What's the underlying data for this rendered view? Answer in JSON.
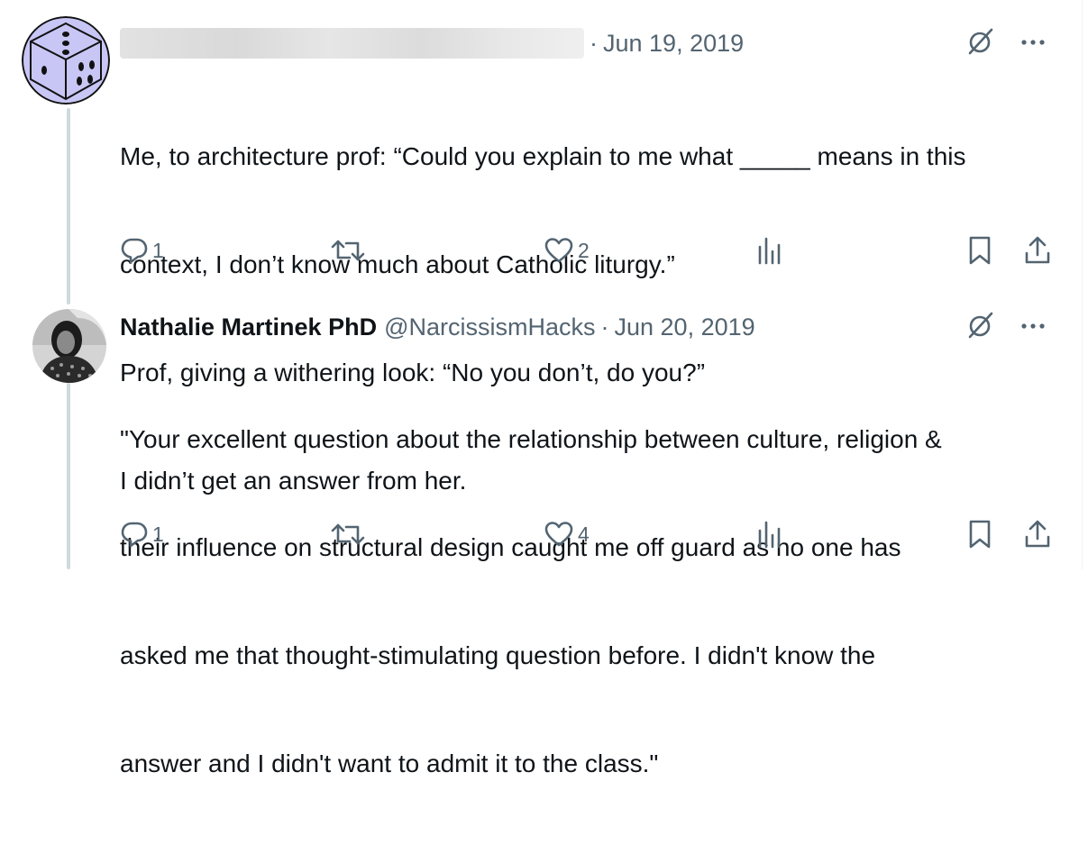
{
  "tweets": [
    {
      "author_name": "",
      "handle": "",
      "separator": "·",
      "date": "Jun 19, 2019",
      "lines": [
        "Me, to architecture prof: “Could you explain to me what _____ means in this",
        "context, I don’t know much about Catholic liturgy.”",
        "Prof, giving a withering look: “No you don’t, do you?”",
        "I didn’t get an answer from her."
      ],
      "reply_count": "1",
      "retweet_count": "",
      "like_count": "2",
      "view_count": ""
    },
    {
      "author_name": "Nathalie Martinek PhD",
      "handle": "@NarcissismHacks",
      "separator": "·",
      "date": "Jun 20, 2019",
      "lines": [
        "\"Your excellent question about the relationship between culture, religion &",
        "their influence on structural design caught me off guard as no one has",
        "asked me that thought-stimulating question before. I didn't know the",
        "answer and I didn't want to admit it to the class.\""
      ],
      "reply_count": "1",
      "retweet_count": "",
      "like_count": "4",
      "view_count": ""
    }
  ],
  "icons": {
    "grok": "grok-icon",
    "more": "more-icon",
    "reply": "reply-icon",
    "retweet": "retweet-icon",
    "like": "like-icon",
    "views": "views-icon",
    "bookmark": "bookmark-icon",
    "share": "share-icon"
  },
  "colors": {
    "text": "#0f1419",
    "secondary": "#536471",
    "thread_line": "#cfd9de",
    "avatar_dice": "#c8c6f5"
  }
}
